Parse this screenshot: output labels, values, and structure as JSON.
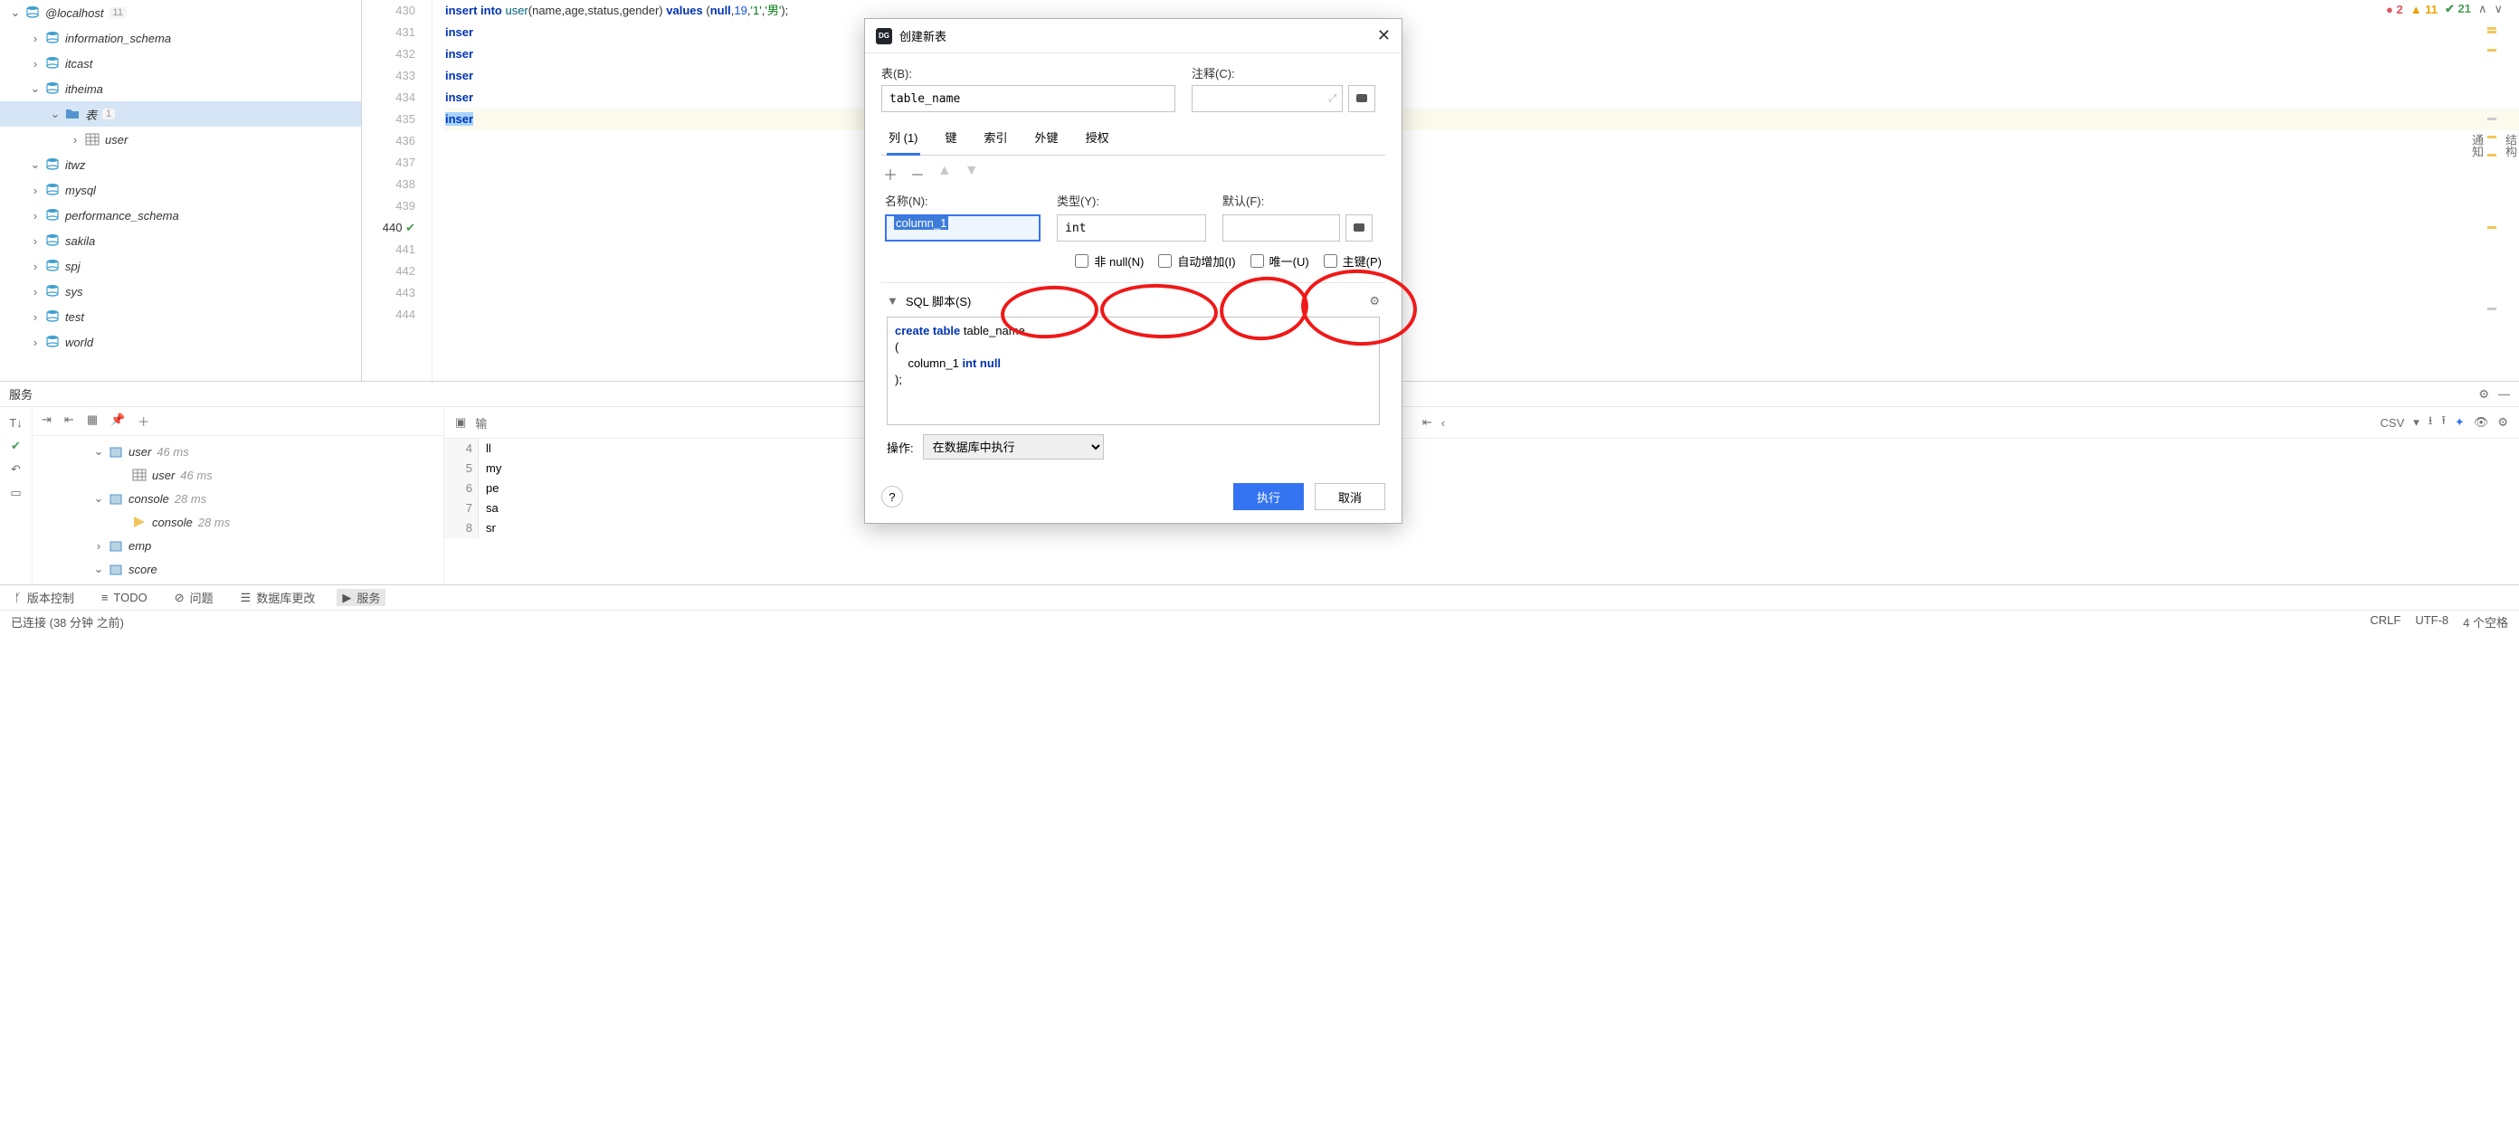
{
  "sidebar": {
    "root": {
      "label": "@localhost",
      "count": "11"
    },
    "items": [
      {
        "label": "information_schema",
        "indent": 1,
        "chev": "›",
        "icon": "db"
      },
      {
        "label": "itcast",
        "indent": 1,
        "chev": "›",
        "icon": "db"
      },
      {
        "label": "itheima",
        "indent": 1,
        "chev": "⌄",
        "icon": "db"
      },
      {
        "label": "表",
        "count": "1",
        "indent": 2,
        "chev": "⌄",
        "icon": "folder",
        "selected": true
      },
      {
        "label": "user",
        "indent": 3,
        "chev": "›",
        "icon": "table"
      },
      {
        "label": "itwz",
        "indent": 1,
        "chev": "⌄",
        "icon": "db"
      },
      {
        "label": "mysql",
        "indent": 1,
        "chev": "›",
        "icon": "db"
      },
      {
        "label": "performance_schema",
        "indent": 1,
        "chev": "›",
        "icon": "db"
      },
      {
        "label": "sakila",
        "indent": 1,
        "chev": "›",
        "icon": "db"
      },
      {
        "label": "spj",
        "indent": 1,
        "chev": "›",
        "icon": "db"
      },
      {
        "label": "sys",
        "indent": 1,
        "chev": "›",
        "icon": "db"
      },
      {
        "label": "test",
        "indent": 1,
        "chev": "›",
        "icon": "db"
      },
      {
        "label": "world",
        "indent": 1,
        "chev": "›",
        "icon": "db"
      }
    ]
  },
  "editor": {
    "lines": {
      "start": 430,
      "current": 440,
      "end": 444
    },
    "code": {
      "l431": "insert into user(name,age,status,gender) values (null,19,'1','男');",
      "l432": "inser",
      "l434": "inser",
      "l437": "inser",
      "l438": "inser",
      "l440": "inser"
    },
    "inspect": {
      "errors": "2",
      "warnings": "11",
      "ok": "21"
    }
  },
  "dialog": {
    "title": "创建新表",
    "table_label": "表(B):",
    "comment_label": "注释(C):",
    "table_value": "table_name",
    "tabs": {
      "columns": "列 (1)",
      "keys": "键",
      "indexes": "索引",
      "fks": "外键",
      "grants": "授权"
    },
    "toolbar": {
      "add": "＋",
      "remove": "－",
      "up": "▲",
      "down": "▼"
    },
    "form": {
      "name_label": "名称(N):",
      "type_label": "类型(Y):",
      "default_label": "默认(F):",
      "name_value": "column_1",
      "type_value": "int"
    },
    "checks": {
      "notnull": "非 null(N)",
      "autoinc": "自动增加(I)",
      "unique": "唯一(U)",
      "pk": "主键(P)"
    },
    "sql": {
      "header": "SQL 脚本(S)",
      "text1": "create table table_name",
      "text2": "(",
      "text3": "    column_1 int null",
      "text4": ");"
    },
    "action_label": "操作:",
    "action_value": "在数据库中执行",
    "ok": "执行",
    "cancel": "取消"
  },
  "services": {
    "title": "服务",
    "tree": [
      {
        "label": "user",
        "ms": "46 ms",
        "indent": 1,
        "chev": "⌄",
        "icon": "svc"
      },
      {
        "label": "user",
        "ms": "46 ms",
        "indent": 2,
        "chev": "",
        "icon": "table"
      },
      {
        "label": "console",
        "ms": "28 ms",
        "indent": 1,
        "chev": "⌄",
        "icon": "svc"
      },
      {
        "label": "console",
        "ms": "28 ms",
        "indent": 2,
        "chev": "",
        "icon": "cons"
      },
      {
        "label": "emp",
        "ms": "",
        "indent": 1,
        "chev": "›",
        "icon": "svc"
      },
      {
        "label": "score",
        "ms": "",
        "indent": 1,
        "chev": "⌄",
        "icon": "svc"
      }
    ],
    "output": "输",
    "csv": "CSV",
    "rows": {
      "r4": "ll",
      "r5": "my",
      "r6": "pe",
      "r7": "sa",
      "r8": "sr"
    }
  },
  "statusbar": {
    "vc": "版本控制",
    "todo": "TODO",
    "problems": "问题",
    "dbchanges": "数据库更改",
    "services": "服务"
  },
  "bottom": {
    "status": "已连接 (38 分钟 之前)",
    "crlf": "CRLF",
    "enc": "UTF-8",
    "spaces": "4 个空格"
  },
  "rside": {
    "struct": "结构",
    "notif": "通知"
  }
}
